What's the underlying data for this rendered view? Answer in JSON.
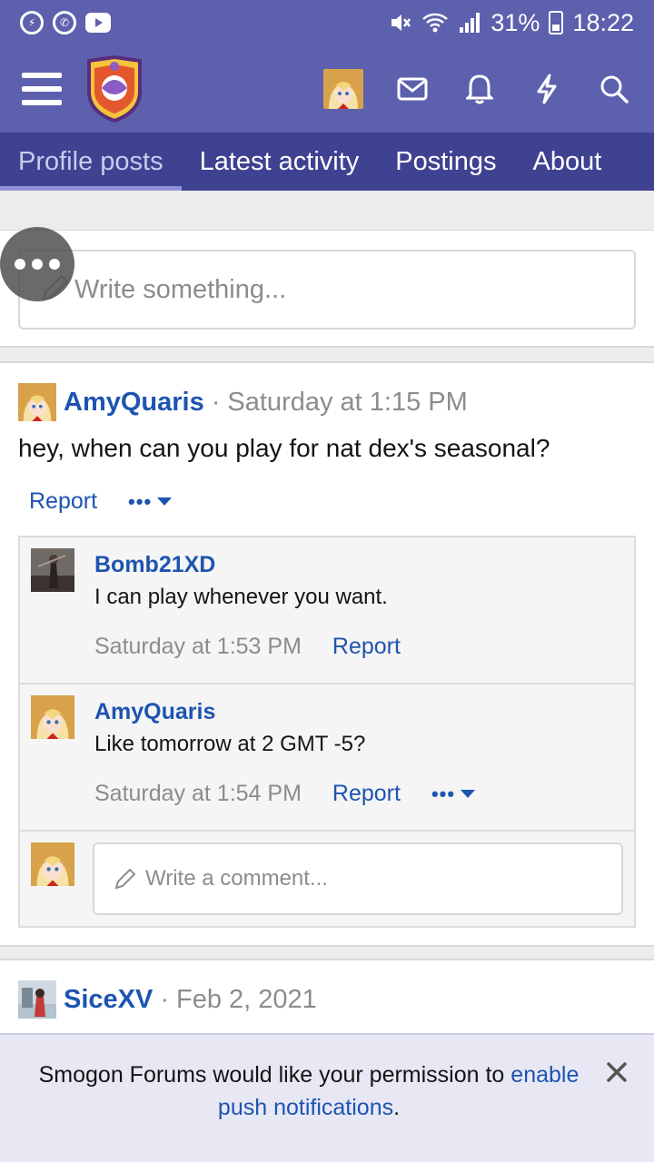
{
  "status_bar": {
    "battery": "31%",
    "time": "18:22"
  },
  "tabs": [
    {
      "label": "Profile posts"
    },
    {
      "label": "Latest activity"
    },
    {
      "label": "Postings"
    },
    {
      "label": "About"
    }
  ],
  "composer": {
    "placeholder": "Write something..."
  },
  "post": {
    "author": "AmyQuaris",
    "separator": "·",
    "time": "Saturday at 1:15 PM",
    "body": "hey, when can you play for nat dex's seasonal?",
    "report_label": "Report",
    "more_label": "•••"
  },
  "comments": [
    {
      "author": "Bomb21XD",
      "text": "I can play whenever you want.",
      "time": "Saturday at 1:53 PM",
      "report_label": "Report"
    },
    {
      "author": "AmyQuaris",
      "text": "Like tomorrow at 2 GMT -5?",
      "time": "Saturday at 1:54 PM",
      "report_label": "Report",
      "more_label": "•••"
    }
  ],
  "reply": {
    "placeholder": "Write a comment..."
  },
  "post2": {
    "author": "SiceXV",
    "separator": "·",
    "time": "Feb 2, 2021"
  },
  "notice": {
    "text": "Smogon Forums would like your permission to",
    "link": "enable push notifications",
    "suffix": "."
  },
  "colors": {
    "header": "#5d60ad",
    "tabs": "#3f4191",
    "link": "#1d54b0"
  }
}
